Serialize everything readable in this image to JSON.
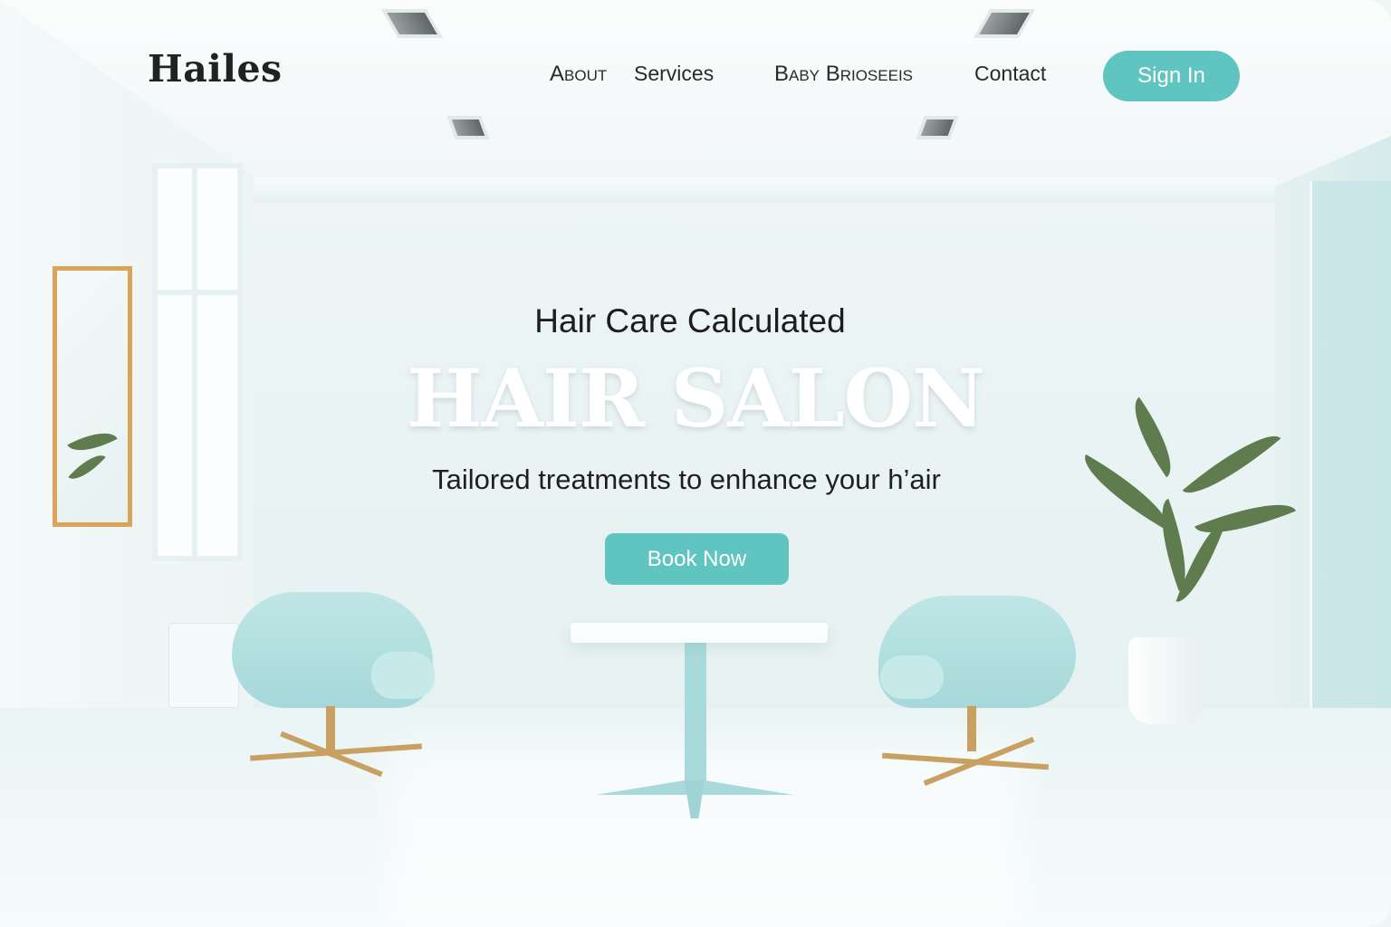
{
  "brand": {
    "logo": "Hailes"
  },
  "nav": {
    "items": [
      {
        "label": "About"
      },
      {
        "label": "Services"
      },
      {
        "label": "Baby Brioseeis"
      },
      {
        "label": "Contact"
      }
    ],
    "sign_in": "Sign In"
  },
  "hero": {
    "kicker": "Hair Care Calculated",
    "title": "HAIR SALON",
    "subtitle": "Tailored treatments to enhance your h’air",
    "cta": "Book Now"
  },
  "colors": {
    "accent": "#60c4c1",
    "chair": "#b4e0e0",
    "gold": "#c8a062"
  }
}
